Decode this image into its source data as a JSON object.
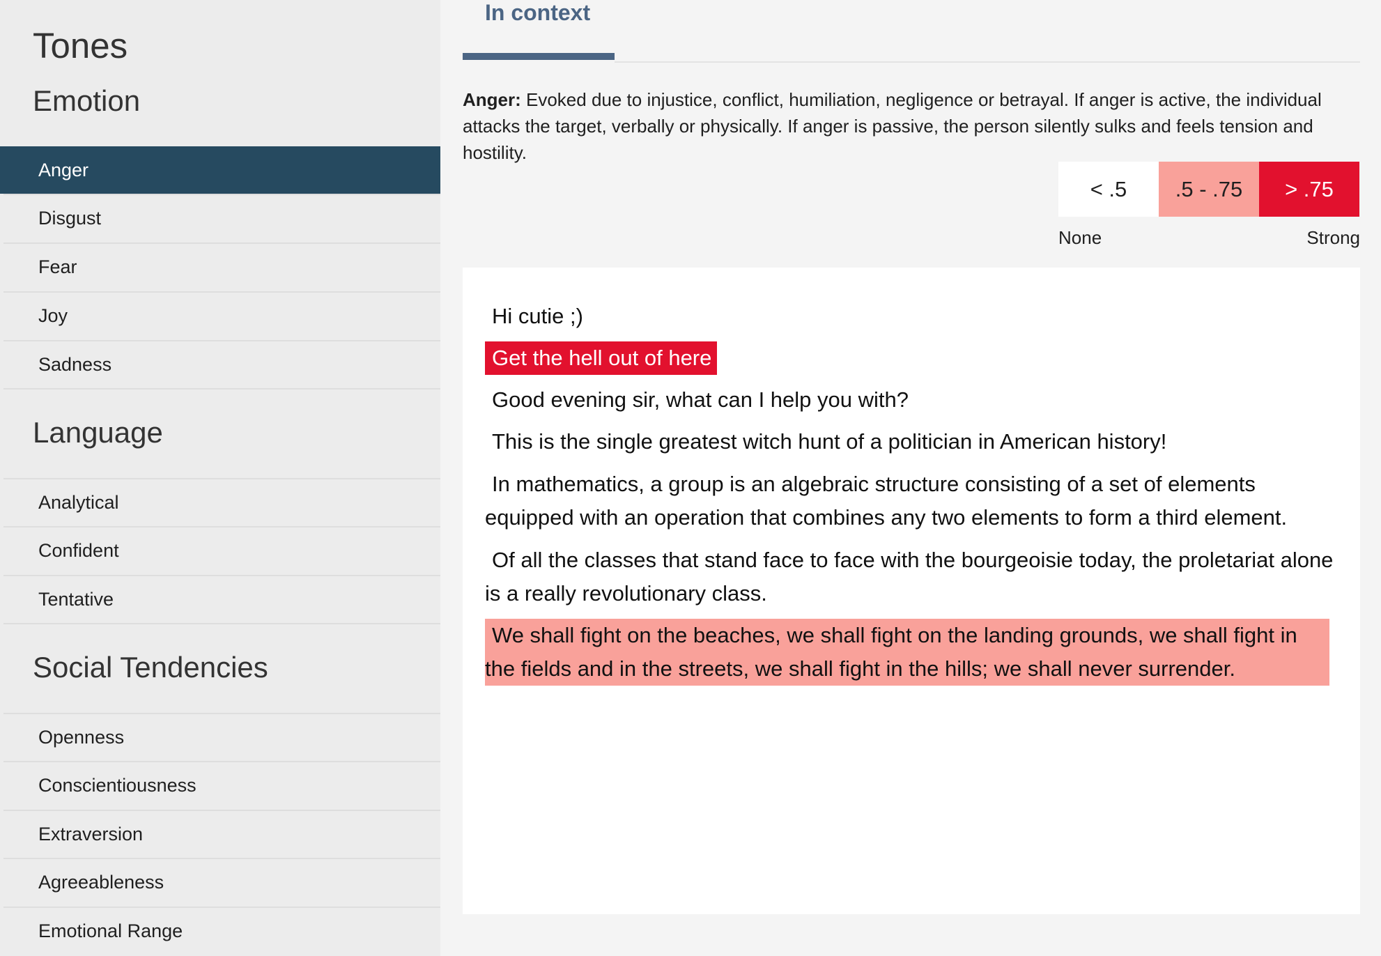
{
  "sidebar": {
    "title": "Tones",
    "groups": [
      {
        "heading": "Emotion",
        "items": [
          "Anger",
          "Disgust",
          "Fear",
          "Joy",
          "Sadness"
        ]
      },
      {
        "heading": "Language",
        "items": [
          "Analytical",
          "Confident",
          "Tentative"
        ]
      },
      {
        "heading": "Social Tendencies",
        "items": [
          "Openness",
          "Conscientiousness",
          "Extraversion",
          "Agreeableness",
          "Emotional Range"
        ]
      }
    ],
    "active_item": "Anger"
  },
  "main": {
    "tab_label": "In context",
    "description": {
      "term": "Anger:",
      "text": " Evoked due to injustice, conflict, humiliation, negligence or betrayal. If anger is active, the individual attacks the target, verbally or physically. If anger is passive, the person silently sulks and feels tension and hostility."
    },
    "legend": {
      "boxes": [
        {
          "label": "< .5",
          "color": "#ffffff",
          "text_color": "#1f1f1f"
        },
        {
          "label": ".5 - .75",
          "color": "#f9a19a",
          "text_color": "#1f1f1f"
        },
        {
          "label": "> .75",
          "color": "#e2112e",
          "text_color": "#ffffff"
        }
      ],
      "low_label": "None",
      "high_label": "Strong"
    },
    "sentences": [
      {
        "text": "Hi cutie ;)",
        "level": "none"
      },
      {
        "text": "Get the hell out of here",
        "level": "strong"
      },
      {
        "text": "Good evening sir, what can I help you with?",
        "level": "none"
      },
      {
        "text": "This is the single greatest witch hunt of a politician in American history!",
        "level": "none"
      },
      {
        "text": "In mathematics, a group is an algebraic structure consisting of a set of elements equipped with an operation that combines any two elements to form a third element.",
        "level": "none"
      },
      {
        "text": "Of all the classes that stand face to face with the bourgeoisie today, the proletariat alone is a really revolutionary class.",
        "level": "none"
      },
      {
        "text": "We shall fight on the beaches, we shall fight on the landing grounds, we shall fight in the fields and in the streets, we shall fight in the hills; we shall never surrender.",
        "level": "medium"
      }
    ]
  }
}
